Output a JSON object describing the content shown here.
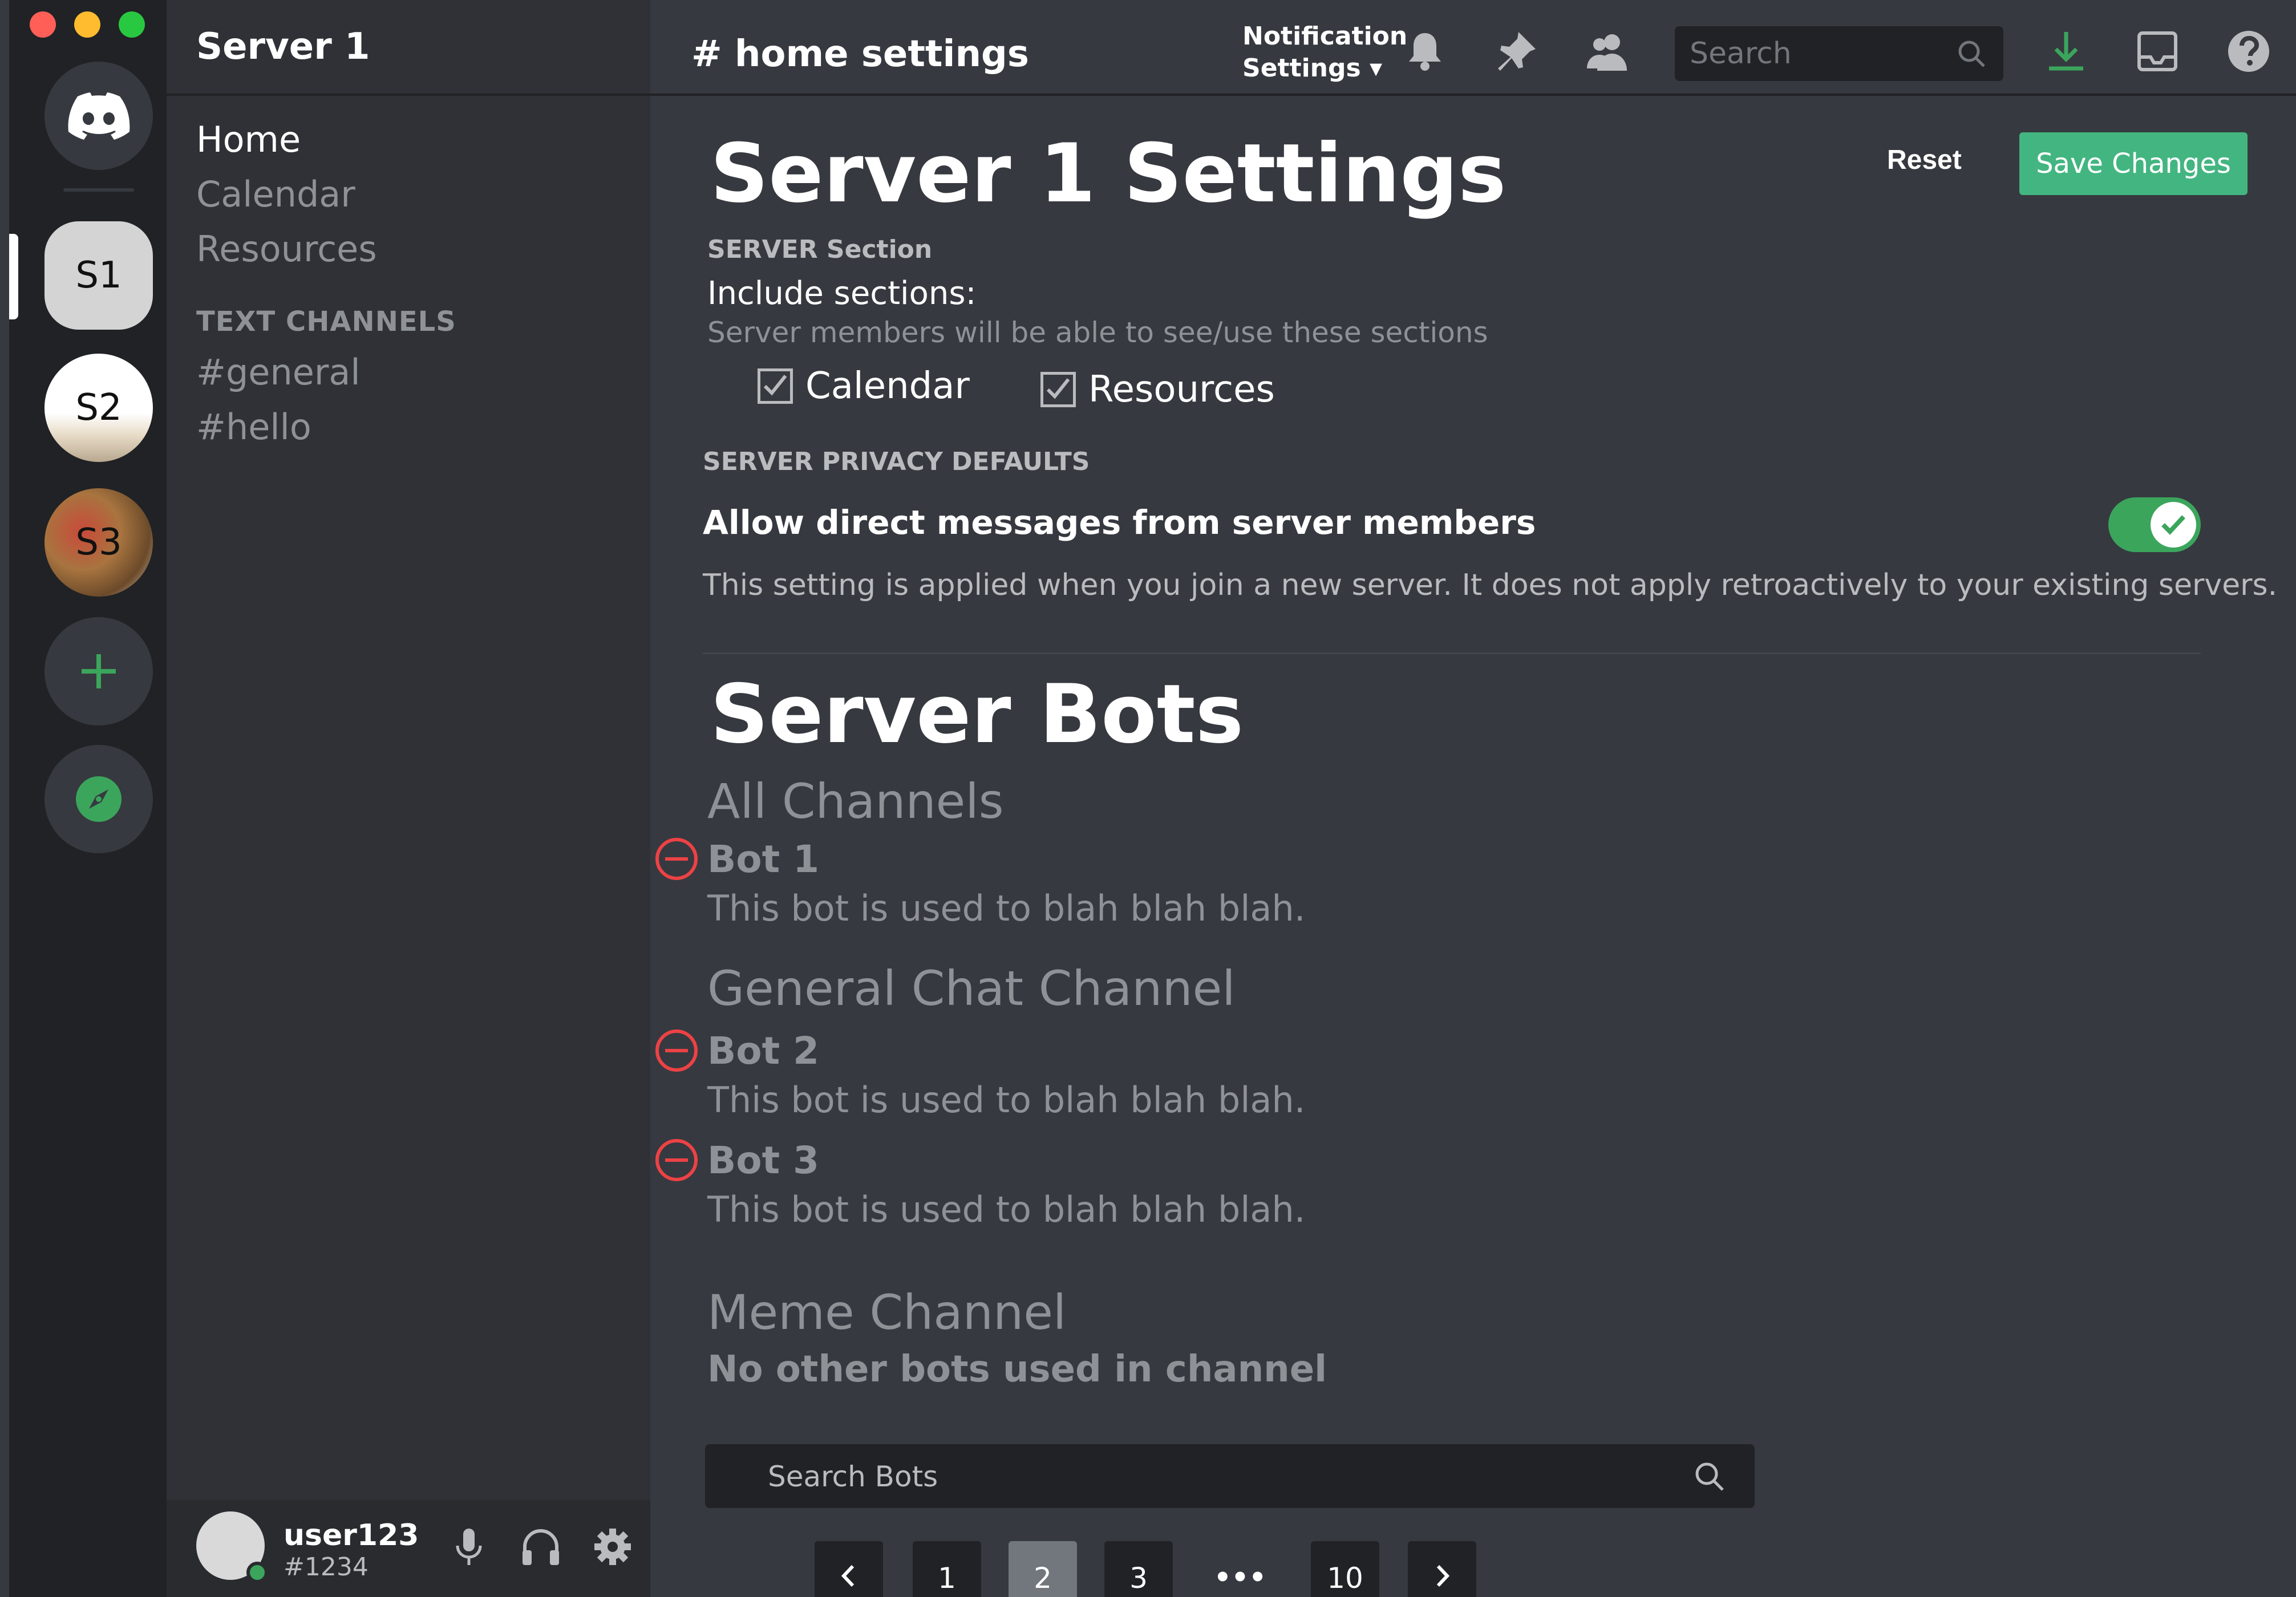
{
  "window": {
    "traffic_colors": [
      "#ff5f57",
      "#febc2e",
      "#28c840"
    ]
  },
  "servers": [
    {
      "label": "S1"
    },
    {
      "label": "S2"
    },
    {
      "label": "S3"
    }
  ],
  "sidebar": {
    "server_name": "Server 1",
    "nav": [
      {
        "label": "Home",
        "active": true
      },
      {
        "label": "Calendar"
      },
      {
        "label": "Resources"
      }
    ],
    "text_channels_label": "TEXT CHANNELS",
    "channels": [
      "#general",
      "#hello"
    ],
    "user": {
      "name": "user123",
      "tag": "#1234",
      "status": "online"
    }
  },
  "topbar": {
    "channel_title": "# home settings",
    "notification_line1": "Notification",
    "notification_line2": "Settings ▾",
    "search_placeholder": "Search"
  },
  "settings": {
    "title": "Server 1 Settings",
    "reset_label": "Reset",
    "save_label": "Save Changes",
    "server_section_label": "SERVER Section",
    "include_label": "Include sections:",
    "include_hint": "Server members will be able to see/use these sections",
    "sections": [
      {
        "label": "Calendar",
        "checked": true
      },
      {
        "label": "Resources",
        "checked": true
      }
    ],
    "privacy_label": "SERVER PRIVACY DEFAULTS",
    "dm_label": "Allow direct messages from server members",
    "dm_enabled": true,
    "dm_hint": "This setting is applied when you join a new server. It does not apply retroactively to your existing servers."
  },
  "bots": {
    "title": "Server Bots",
    "groups": [
      {
        "name": "All Channels",
        "bots": [
          {
            "name": "Bot 1",
            "desc": "This bot is used to blah blah blah."
          }
        ]
      },
      {
        "name": "General Chat Channel",
        "bots": [
          {
            "name": "Bot 2",
            "desc": "This bot is used to blah blah blah."
          },
          {
            "name": "Bot 3",
            "desc": "This bot is used to blah blah blah."
          }
        ]
      },
      {
        "name": "Meme Channel",
        "empty_text": "No other bots used in channel"
      }
    ],
    "search_placeholder": "Search Bots",
    "pagination": {
      "pages": [
        "1",
        "2",
        "3",
        "•••",
        "10"
      ],
      "current": "2"
    }
  },
  "colors": {
    "accent": "#43b581",
    "danger": "#ed4245",
    "blurple": "#5865f2"
  }
}
